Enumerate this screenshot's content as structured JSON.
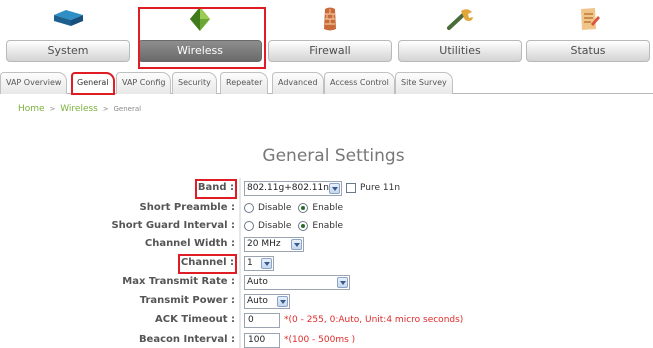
{
  "topnav": {
    "items": [
      {
        "label": "System",
        "icon": "router-icon"
      },
      {
        "label": "Wireless",
        "icon": "antenna-icon"
      },
      {
        "label": "Firewall",
        "icon": "firewall-icon"
      },
      {
        "label": "Utilities",
        "icon": "wrench-icon"
      },
      {
        "label": "Status",
        "icon": "notepad-icon"
      }
    ],
    "active": "Wireless"
  },
  "subtabs": {
    "items": [
      "VAP Overview",
      "General",
      "VAP Config",
      "Security",
      "Repeater",
      "Advanced",
      "Access Control",
      "Site Survey"
    ],
    "active": "General"
  },
  "breadcrumb": {
    "home": "Home",
    "section": "Wireless",
    "current": "General",
    "separator": ">"
  },
  "page": {
    "title": "General Settings"
  },
  "form": {
    "band": {
      "label": "Band :",
      "value": "802.11g+802.11n",
      "pure11n_label": "Pure 11n",
      "pure11n_checked": false
    },
    "short_preamble": {
      "label": "Short Preamble :",
      "option1": "Disable",
      "option2": "Enable",
      "selected": "Enable"
    },
    "short_guard_interval": {
      "label": "Short Guard Interval :",
      "option1": "Disable",
      "option2": "Enable",
      "selected": "Enable"
    },
    "channel_width": {
      "label": "Channel Width :",
      "value": "20 MHz"
    },
    "channel": {
      "label": "Channel :",
      "value": "1"
    },
    "max_transmit_rate": {
      "label": "Max Transmit Rate :",
      "value": "Auto"
    },
    "transmit_power": {
      "label": "Transmit Power :",
      "value": "Auto"
    },
    "ack_timeout": {
      "label": "ACK Timeout :",
      "value": "0",
      "hint": "*(0 - 255, 0:Auto, Unit:4 micro seconds)"
    },
    "beacon_interval": {
      "label": "Beacon Interval :",
      "value": "100",
      "hint": "*(100 - 500ms )"
    }
  },
  "colors": {
    "highlight": "#e01c24",
    "breadcrumb": "#7ab23b",
    "hint": "#e02b2b",
    "active_button": "#767676"
  }
}
